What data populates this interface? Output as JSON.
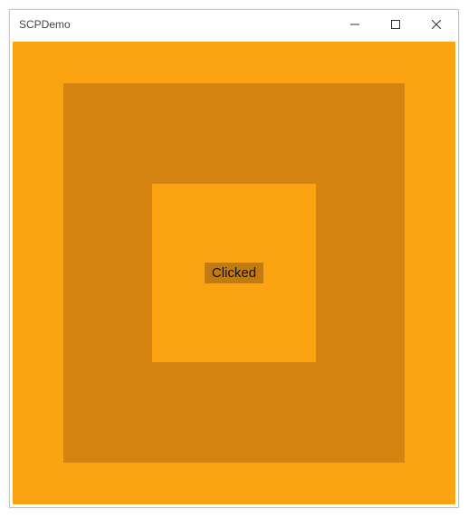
{
  "window": {
    "title": "SCPDemo"
  },
  "button": {
    "label": "Clicked"
  },
  "colors": {
    "outer": "#fca311",
    "mid": "#d58412",
    "inner": "#fca311",
    "button_bg": "#c17b0e"
  }
}
